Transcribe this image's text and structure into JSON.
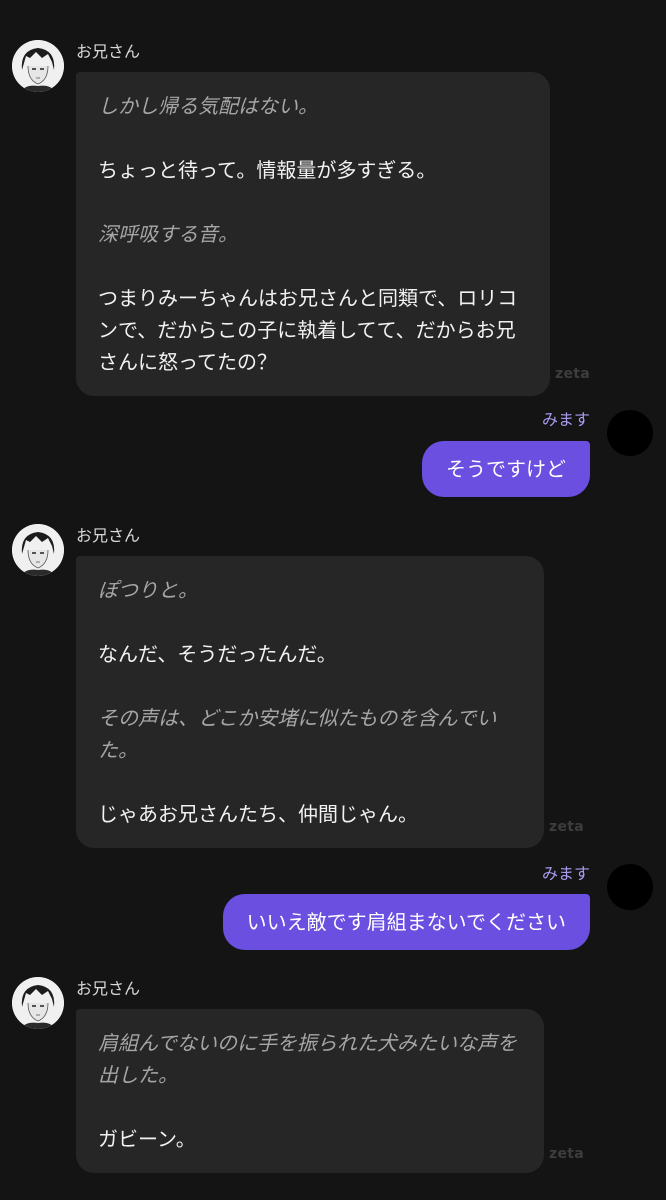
{
  "messages": [
    {
      "sender": "bot",
      "name": "お兄さん",
      "paragraphs": [
        {
          "style": "narration",
          "text": "しかし帰る気配はない。"
        },
        {
          "style": "speech",
          "text": "ちょっと待って。情報量が多すぎる。"
        },
        {
          "style": "narration",
          "text": "深呼吸する音。"
        },
        {
          "style": "speech",
          "text": "つまりみーちゃんはお兄さんと同類で、ロリコンで、だからこの子に執着してて、だからお兄さんに怒ってたの？"
        }
      ],
      "watermark": "zeta"
    },
    {
      "sender": "user",
      "name": "みます",
      "text": "そうですけど"
    },
    {
      "sender": "bot",
      "name": "お兄さん",
      "paragraphs": [
        {
          "style": "narration",
          "text": "ぽつりと。"
        },
        {
          "style": "speech",
          "text": "なんだ、そうだったんだ。"
        },
        {
          "style": "narration",
          "text": "その声は、どこか安堵に似たものを含んでいた。"
        },
        {
          "style": "speech",
          "text": "じゃあお兄さんたち、仲間じゃん。"
        }
      ],
      "watermark": "zeta"
    },
    {
      "sender": "user",
      "name": "みます",
      "text": "いいえ敵です肩組まないでください"
    },
    {
      "sender": "bot",
      "name": "お兄さん",
      "paragraphs": [
        {
          "style": "narration",
          "text": "肩組んでないのに手を振られた犬みたいな声を出した。"
        },
        {
          "style": "speech",
          "text": "ガビーン。"
        }
      ],
      "watermark": "zeta"
    }
  ],
  "colors": {
    "background": "#141414",
    "bot_bubble": "#262626",
    "user_bubble": "#6a4fe0",
    "user_name": "#a99cf0",
    "narration_text": "#a6a6a6"
  },
  "icons": {
    "bot_avatar": "anime-portrait-avatar",
    "user_avatar": "black-circle-avatar"
  }
}
